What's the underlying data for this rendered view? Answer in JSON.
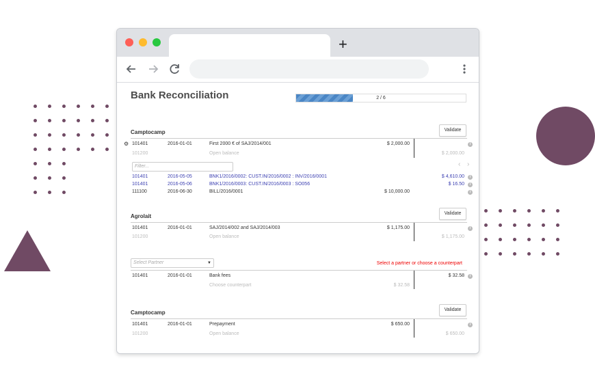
{
  "app": {
    "title": "Bank Reconciliation",
    "progress": {
      "text": "2 / 6",
      "fraction": 0.333
    }
  },
  "browser": {
    "new_tab_glyph": "+",
    "icons": [
      "back-arrow-icon",
      "forward-arrow-icon",
      "reload-icon",
      "kebab-menu-icon"
    ]
  },
  "colors": {
    "accent": "#704a64",
    "progress": "#4a86c5",
    "link": "#3b3fb1",
    "error": "#e00000"
  },
  "sections": [
    {
      "partner": "Camptocamp",
      "validate_label": "Validate",
      "line": {
        "account": "101401",
        "date": "2016-01-01",
        "label": "First 2000 € of SAJ/2014/001",
        "amount": "$ 2,000.00"
      },
      "balance": {
        "account": "101200",
        "label": "Open balance",
        "amount": "$ 2,000.00"
      },
      "filter_placeholder": "Filter...",
      "matches": [
        {
          "account": "101401",
          "date": "2016-05-05",
          "label": "BNK1/2016/0002: CUST.IN/2016/0002 : INV/2016/0001",
          "amount": "$ 4,610.00",
          "linked": true
        },
        {
          "account": "101401",
          "date": "2016-05-06",
          "label": "BNK1/2016/0003: CUST.IN/2016/0003 : SO056",
          "amount": "$ 16.50",
          "linked": true
        },
        {
          "account": "111100",
          "date": "2016-06-30",
          "label": "BILL/2016/0001",
          "amount": "$ 10,000.00",
          "linked": false
        }
      ]
    },
    {
      "partner": "Agrolait",
      "validate_label": "Validate",
      "line": {
        "account": "101401",
        "date": "2016-01-01",
        "label": "SAJ/2014/002 and SAJ/2014/003",
        "amount": "$ 1,175.00"
      },
      "balance": {
        "account": "101200",
        "label": "Open balance",
        "amount": "$ 1,175.00"
      }
    },
    {
      "select_partner_placeholder": "Select Partner",
      "warning": "Select a partner or choose a counterpart",
      "line": {
        "account": "101401",
        "date": "2016-01-01",
        "label": "Bank fees",
        "amount": "$ 32.58"
      },
      "balance": {
        "label": "Choose counterpart",
        "amount": "$ 32.58"
      }
    },
    {
      "partner": "Camptocamp",
      "validate_label": "Validate",
      "line": {
        "account": "101401",
        "date": "2016-01-01",
        "label": "Prepayment",
        "amount": "$ 650.00"
      },
      "balance": {
        "account": "101200",
        "label": "Open balance",
        "amount": "$ 650.00"
      }
    }
  ]
}
